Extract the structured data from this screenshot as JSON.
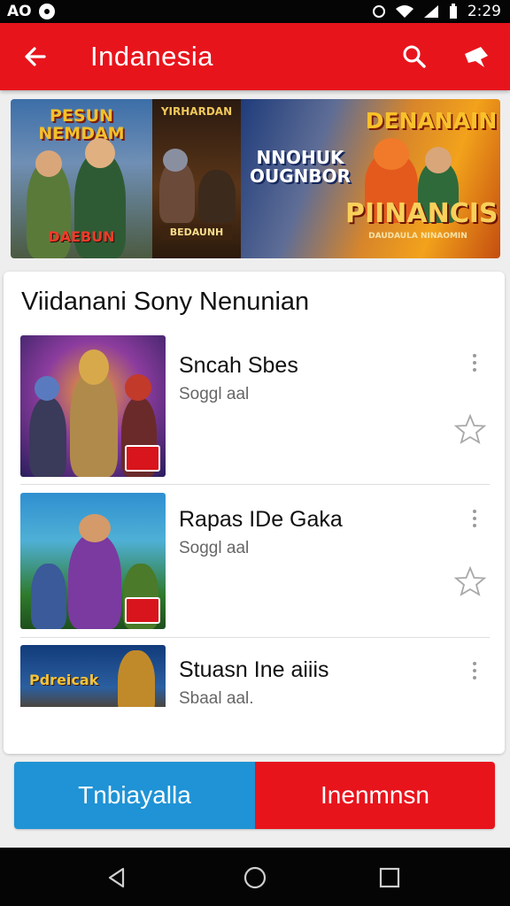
{
  "status_bar": {
    "left_text": "AO",
    "time": "2:29"
  },
  "app_bar": {
    "title": "Indanesia"
  },
  "banner": {
    "panel_1_title": "PESUN NEMDAM",
    "panel_1_footer": "DAEBUN",
    "panel_2_title": "YIRHARDAN",
    "panel_2_footer": "BEDAUNH",
    "panel_3_left": "NNOHUK OUGNBOR",
    "panel_3_top": "DENANAIN",
    "panel_3_main": "PIINANCIS",
    "panel_3_small": "DAUDAULA NINAOMIN"
  },
  "section": {
    "title": "Viidanani Sony Nenunian"
  },
  "apps": [
    {
      "name": "Sncah Sbes",
      "subtitle": "Soggl aal"
    },
    {
      "name": "Rapas IDe Gaka",
      "subtitle": "Soggl aal"
    },
    {
      "name": "Stuasn Ine aiiis",
      "subtitle": "Sbaal aal.",
      "thumb_label": "Pdreicak"
    }
  ],
  "actions": {
    "primary": "Tnbiayalla",
    "secondary": "Inenmnsn"
  },
  "colors": {
    "accent_red": "#e8141c",
    "accent_blue": "#1f93d5"
  },
  "icons": [
    "arrow-left-icon",
    "search-icon",
    "share-icon",
    "more-vert-icon",
    "star-outline-icon",
    "back-triangle-icon",
    "home-circle-icon",
    "recents-square-icon"
  ]
}
